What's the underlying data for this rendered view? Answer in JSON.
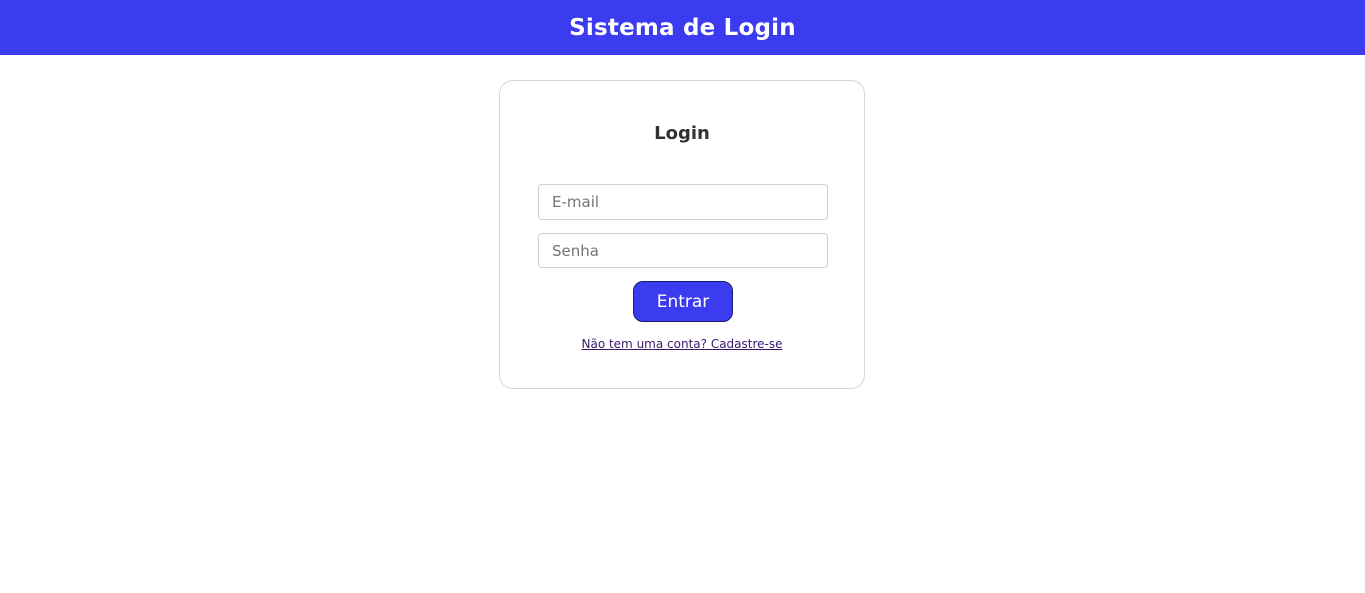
{
  "header": {
    "title": "Sistema de Login",
    "background_color": "#3b3bf0"
  },
  "login_card": {
    "title": "Login",
    "email_field": {
      "value": "",
      "placeholder": "E-mail"
    },
    "password_field": {
      "value": "",
      "placeholder": "Senha"
    },
    "submit_label": "Entrar",
    "signup_link_text": "Não tem uma conta? Cadastre-se"
  }
}
